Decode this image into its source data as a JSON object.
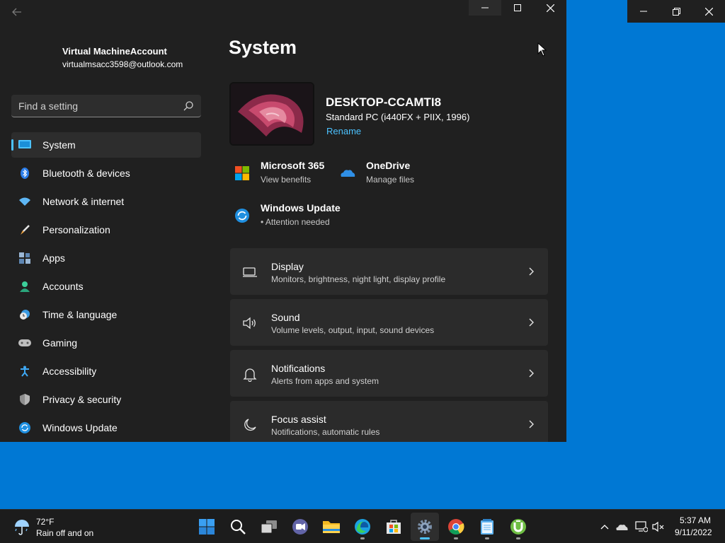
{
  "window": {
    "page_title": "System"
  },
  "profile": {
    "name": "Virtual MachineAccount",
    "email": "virtualmsacc3598@outlook.com"
  },
  "search": {
    "placeholder": "Find a setting"
  },
  "sidebar": {
    "items": [
      {
        "label": "System",
        "icon": "system-icon",
        "active": true
      },
      {
        "label": "Bluetooth & devices",
        "icon": "bluetooth-icon"
      },
      {
        "label": "Network & internet",
        "icon": "wifi-icon"
      },
      {
        "label": "Personalization",
        "icon": "brush-icon"
      },
      {
        "label": "Apps",
        "icon": "apps-icon"
      },
      {
        "label": "Accounts",
        "icon": "accounts-icon"
      },
      {
        "label": "Time & language",
        "icon": "clock-globe-icon"
      },
      {
        "label": "Gaming",
        "icon": "gamepad-icon"
      },
      {
        "label": "Accessibility",
        "icon": "accessibility-icon"
      },
      {
        "label": "Privacy & security",
        "icon": "shield-icon"
      },
      {
        "label": "Windows Update",
        "icon": "update-icon"
      }
    ]
  },
  "pc": {
    "name": "DESKTOP-CCAMTI8",
    "model": "Standard PC (i440FX + PIIX, 1996)",
    "rename": "Rename"
  },
  "quick_links": {
    "m365": {
      "title": "Microsoft 365",
      "subtitle": "View benefits"
    },
    "onedrive": {
      "title": "OneDrive",
      "subtitle": "Manage files"
    },
    "update": {
      "title": "Windows Update",
      "subtitle": "• Attention needed"
    }
  },
  "cards": [
    {
      "title": "Display",
      "subtitle": "Monitors, brightness, night light, display profile",
      "icon": "monitor-icon"
    },
    {
      "title": "Sound",
      "subtitle": "Volume levels, output, input, sound devices",
      "icon": "speaker-icon"
    },
    {
      "title": "Notifications",
      "subtitle": "Alerts from apps and system",
      "icon": "bell-icon"
    },
    {
      "title": "Focus assist",
      "subtitle": "Notifications, automatic rules",
      "icon": "moon-icon"
    }
  ],
  "taskbar": {
    "weather": {
      "temp": "72°F",
      "desc": "Rain off and on"
    },
    "clock": {
      "time": "5:37 AM",
      "date": "9/11/2022"
    }
  },
  "colors": {
    "accent": "#4cc2ff",
    "desktop": "#0078d4",
    "window_bg": "#202020",
    "card_bg": "#2b2b2b"
  }
}
